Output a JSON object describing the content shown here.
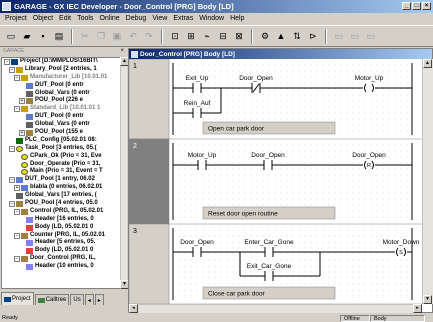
{
  "app": {
    "title": "GARAGE - GX IEC Developer - Door_Control [PRG] Body [LD]",
    "window_buttons": [
      "_",
      "□",
      "×"
    ]
  },
  "menu": [
    "Project",
    "Object",
    "Edit",
    "Tools",
    "Online",
    "Debug",
    "View",
    "Extras",
    "Window",
    "Help"
  ],
  "toolbar_icons": [
    "new-icon",
    "open-icon",
    "save-icon",
    "print-icon",
    "cut-icon",
    "copy-icon",
    "paste-icon",
    "undo-icon",
    "redo-icon",
    "ld-icon",
    "fbd-icon",
    "il-icon",
    "sfc-icon",
    "st-icon",
    "monitor-icon",
    "compile-icon",
    "transfer-icon",
    "online-icon",
    "zoom-icon",
    "grid-icon",
    "window-icon"
  ],
  "panel": {
    "header": "GARAGE",
    "tree": [
      {
        "toggle": "−",
        "indent": 0,
        "icon": "proj",
        "label": "Project [D:\\MMPLUS\\16BIT\\"
      },
      {
        "toggle": "−",
        "indent": 1,
        "icon": "fold",
        "label": "Library_Pool [2 entries, 1"
      },
      {
        "toggle": "−",
        "indent": 2,
        "icon": "fold",
        "label": "Manufacturer_Lib [10.01.01",
        "gray": true
      },
      {
        "toggle": "",
        "indent": 3,
        "icon": "dut",
        "label": "DUT_Pool (0 entr"
      },
      {
        "toggle": "",
        "indent": 3,
        "icon": "gv",
        "label": "Global_Vars (0 entr"
      },
      {
        "toggle": "+",
        "indent": 3,
        "icon": "pou",
        "label": "POU_Pool (226 e"
      },
      {
        "toggle": "−",
        "indent": 2,
        "icon": "fold",
        "label": "Standard_Lib [10.01.01 1",
        "gray": true
      },
      {
        "toggle": "",
        "indent": 3,
        "icon": "dut",
        "label": "DUT_Pool (0 entr"
      },
      {
        "toggle": "",
        "indent": 3,
        "icon": "gv",
        "label": "Global_Vars (0 entr"
      },
      {
        "toggle": "+",
        "indent": 3,
        "icon": "pou",
        "label": "POU_Pool (155 e"
      },
      {
        "toggle": "",
        "indent": 1,
        "icon": "cfg",
        "label": "PLC_Config [05.02.01 08:"
      },
      {
        "toggle": "−",
        "indent": 1,
        "icon": "task",
        "label": "Task_Pool [3 entries, 05.("
      },
      {
        "toggle": "",
        "indent": 2,
        "icon": "task",
        "label": "CPark_Ok (Prio = 31, Eve"
      },
      {
        "toggle": "",
        "indent": 2,
        "icon": "task",
        "label": "Door_Operate (Prio = 31,"
      },
      {
        "toggle": "",
        "indent": 2,
        "icon": "task",
        "label": "Main (Prio = 31, Event = T"
      },
      {
        "toggle": "−",
        "indent": 1,
        "icon": "dut",
        "label": "DUT_Pool [1 entry, 06.02"
      },
      {
        "toggle": "+",
        "indent": 2,
        "icon": "dut",
        "label": "blabla (0 entries, 06.02.01"
      },
      {
        "toggle": "",
        "indent": 1,
        "icon": "gv",
        "label": "Global_Vars [17 entries, ("
      },
      {
        "toggle": "−",
        "indent": 1,
        "icon": "pou",
        "label": "POU_Pool [4 entries, 05.0"
      },
      {
        "toggle": "−",
        "indent": 2,
        "icon": "pou",
        "label": "Control (PRG, IL, 05.02.01"
      },
      {
        "toggle": "",
        "indent": 3,
        "icon": "hdr",
        "label": "Header [16 entries, 0"
      },
      {
        "toggle": "",
        "indent": 3,
        "icon": "body",
        "label": "Body (LD, 05.02.01 0"
      },
      {
        "toggle": "−",
        "indent": 2,
        "icon": "pou",
        "label": "Counter (PRG, IL, 05.02.01"
      },
      {
        "toggle": "",
        "indent": 3,
        "icon": "hdr",
        "label": "Header [5 entries, 05."
      },
      {
        "toggle": "",
        "indent": 3,
        "icon": "body",
        "label": "Body (LD, 05.02.01 0"
      },
      {
        "toggle": "−",
        "indent": 2,
        "icon": "pou",
        "label": "Door_Control (PRG, IL,"
      },
      {
        "toggle": "",
        "indent": 3,
        "icon": "hdr",
        "label": "Header (10 entries, 0"
      }
    ],
    "tabs": [
      "Project",
      "Calltree",
      "Us"
    ]
  },
  "editor": {
    "title": "Door_Control [PRG] Body [LD]",
    "networks": [
      {
        "number": "1",
        "comment": "Open car park door",
        "contacts": [
          "Exit_Up",
          "Door_Open",
          "Rein_Auf"
        ],
        "contact_symbols": [
          "|  |",
          "|/|",
          "|  |"
        ],
        "coil": "Motor_Up",
        "coil_symbol": "( )"
      },
      {
        "number": "2",
        "comment": "Reset door open routine",
        "contacts": [
          "Motor_Up",
          "Door_Open"
        ],
        "contact_symbols": [
          "|  |",
          "|  |"
        ],
        "coil": "Door_Open",
        "coil_symbol": "(R)"
      },
      {
        "number": "3",
        "comment": "Close car park door",
        "contacts": [
          "Door_Open",
          "Enter_Car_Gone",
          "Exit_Car_Gone"
        ],
        "contact_symbols": [
          "|  |",
          "|  |",
          "|  |"
        ],
        "coil": "Motor_Down",
        "coil_symbol": "(S)"
      }
    ]
  },
  "status": {
    "left": "Ready",
    "mode": "Offline",
    "object": "Body"
  }
}
